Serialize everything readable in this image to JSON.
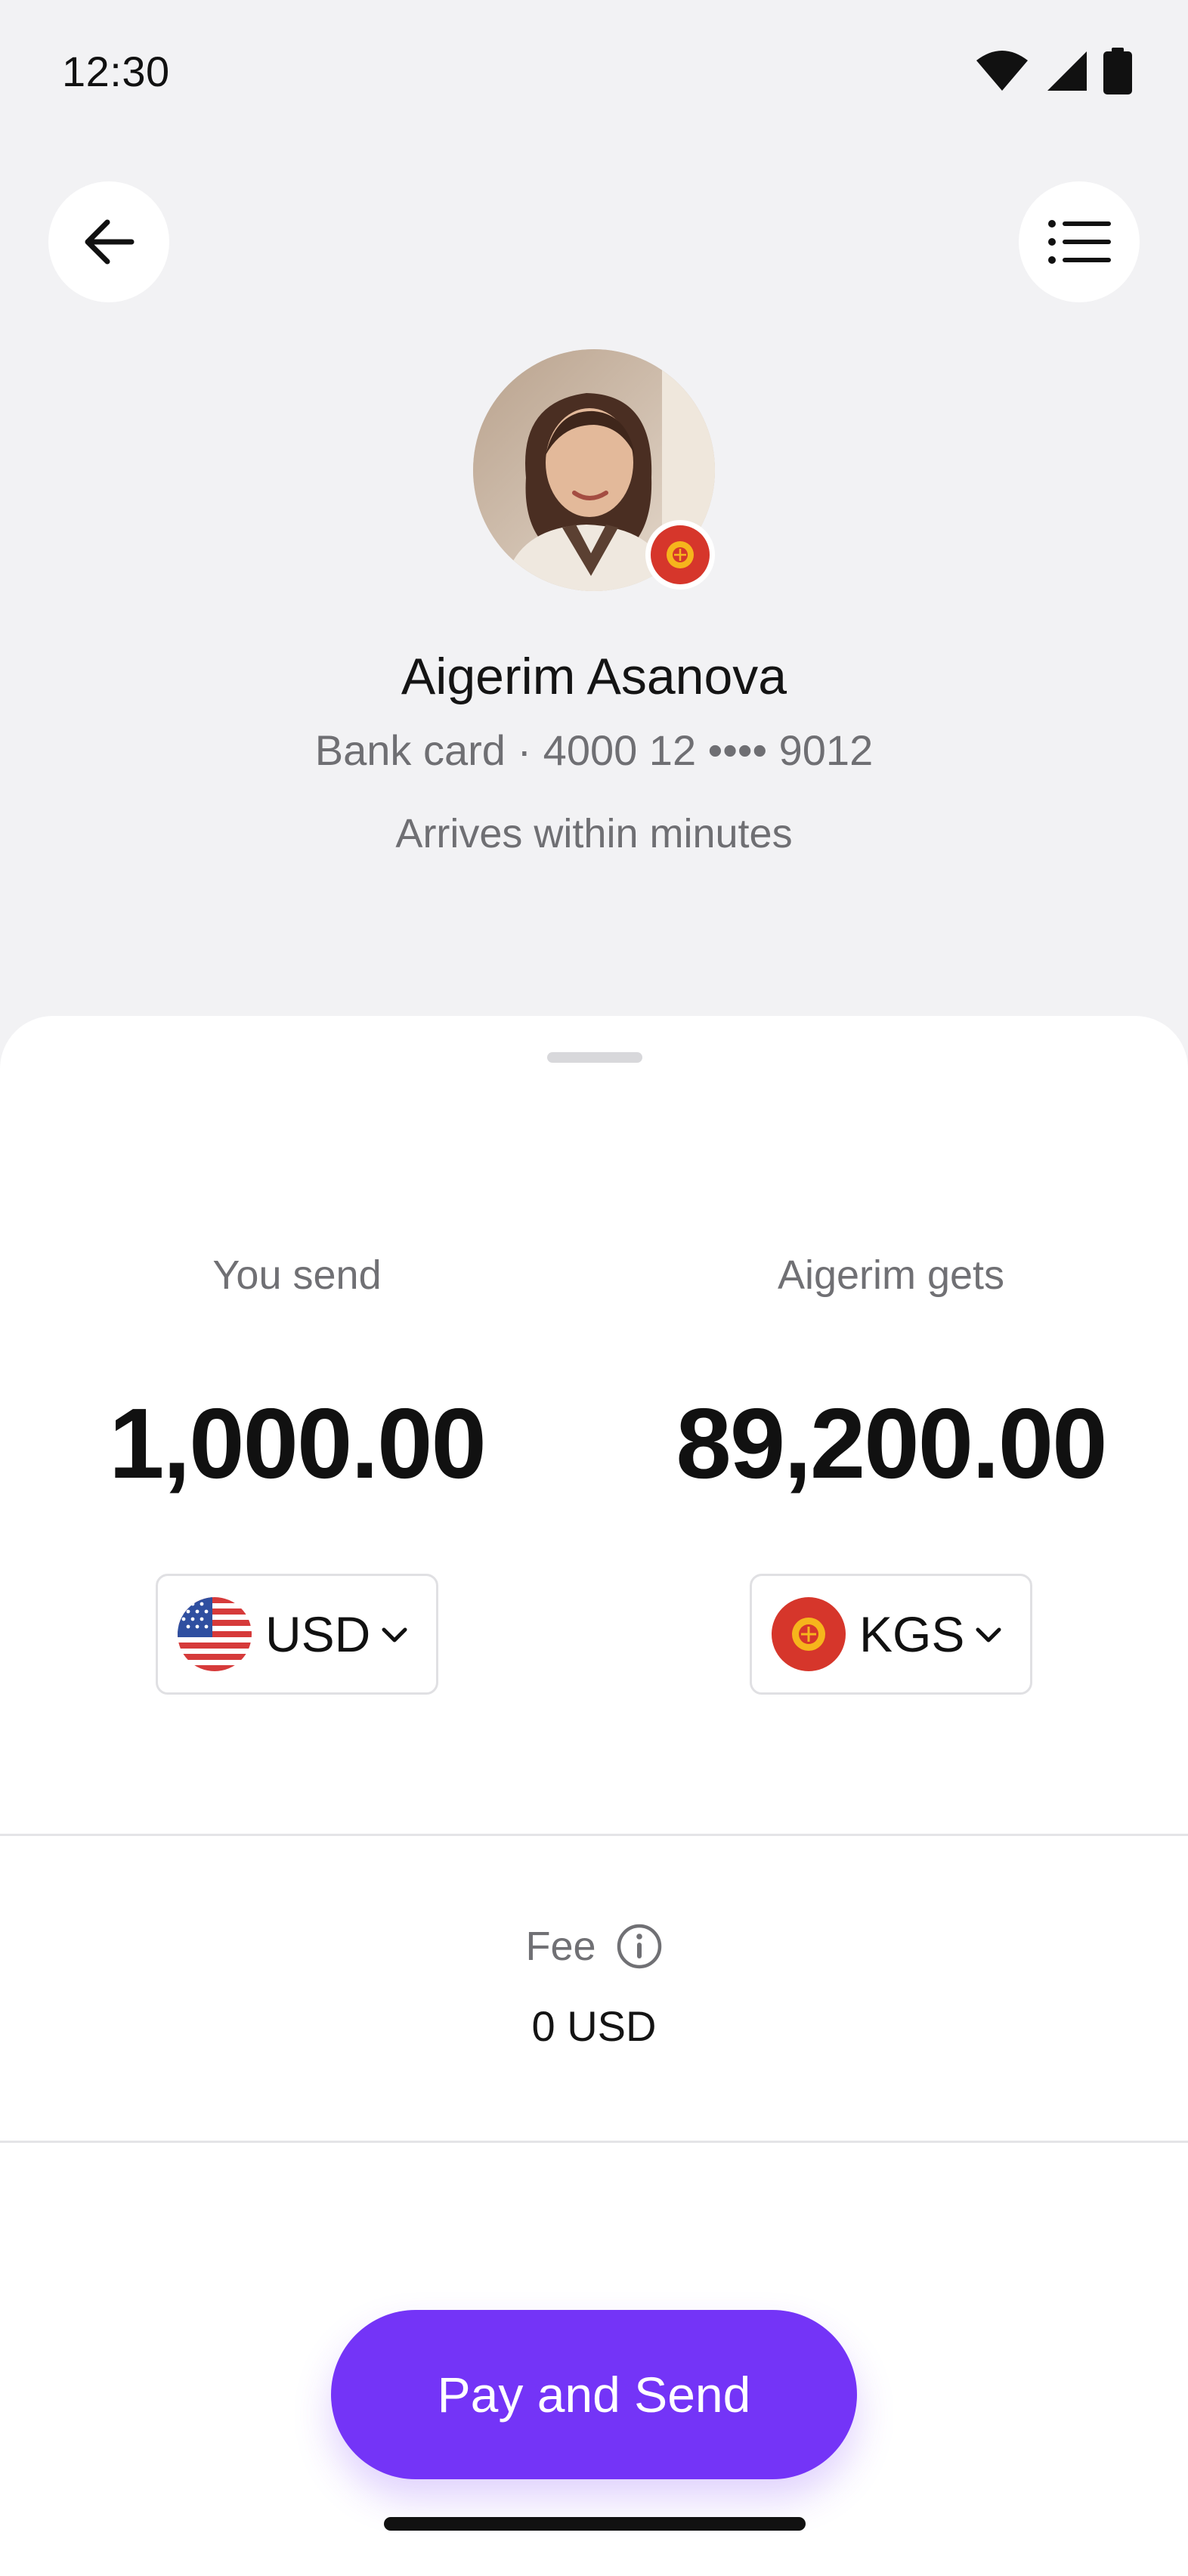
{
  "status_bar": {
    "time": "12:30"
  },
  "header": {
    "back_icon": "arrow-left-icon",
    "menu_icon": "list-icon"
  },
  "recipient": {
    "name": "Aigerim Asanova",
    "card": "Bank card · 4000 12 •••• 9012",
    "eta": "Arrives within minutes",
    "flag_icon": "kyrgyzstan-flag-icon"
  },
  "transfer": {
    "send": {
      "label": "You send",
      "amount": "1,000.00",
      "currency": "USD",
      "flag_icon": "us-flag-icon"
    },
    "receive": {
      "label": "Aigerim gets",
      "amount": "89,200.00",
      "currency": "KGS",
      "flag_icon": "kyrgyzstan-flag-icon"
    }
  },
  "fee": {
    "label": "Fee",
    "value": "0 USD",
    "info_icon": "info-icon"
  },
  "actions": {
    "primary_label": "Pay and Send"
  },
  "colors": {
    "accent": "#7434f7",
    "background": "#f2f2f4",
    "sheet": "#ffffff",
    "muted_text": "#6f6f73"
  }
}
